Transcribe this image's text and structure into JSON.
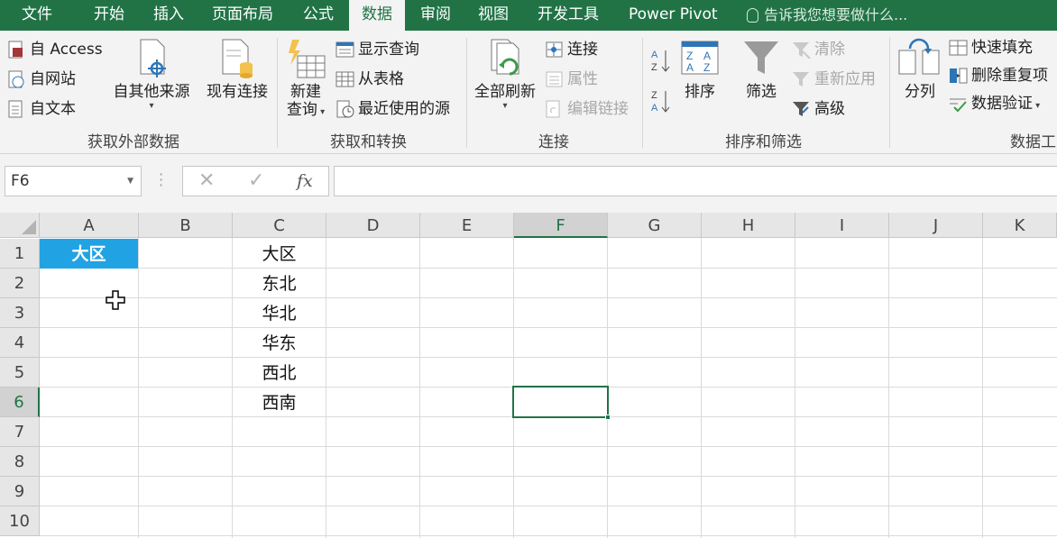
{
  "tabs": [
    "文件",
    "开始",
    "插入",
    "页面布局",
    "公式",
    "数据",
    "审阅",
    "视图",
    "开发工具",
    "Power Pivot"
  ],
  "active_tab": "数据",
  "tell_me": "告诉我您想要做什么...",
  "ribbon": {
    "get_external": {
      "label": "获取外部数据",
      "from_access": "自 Access",
      "from_web": "自网站",
      "from_text": "自文本",
      "other_sources": "自其他来源",
      "existing_connections": "现有连接"
    },
    "get_transform": {
      "label": "获取和转换",
      "new_query_1": "新建",
      "new_query_2": "查询",
      "show_queries": "显示查询",
      "from_table": "从表格",
      "recent_sources": "最近使用的源"
    },
    "connections": {
      "label": "连接",
      "refresh_all": "全部刷新",
      "connections": "连接",
      "properties": "属性",
      "edit_links": "编辑链接"
    },
    "sort_filter": {
      "label": "排序和筛选",
      "sort": "排序",
      "filter": "筛选",
      "clear": "清除",
      "reapply": "重新应用",
      "advanced": "高级"
    },
    "data_tools": {
      "label": "数据工",
      "text_to_columns": "分列",
      "flash_fill": "快速填充",
      "remove_duplicates": "删除重复项",
      "data_validation": "数据验证"
    }
  },
  "name_box": "F6",
  "formula_fx": "fx",
  "formula_value": "",
  "columns": [
    "A",
    "B",
    "C",
    "D",
    "E",
    "F",
    "G",
    "H",
    "I",
    "J",
    "K"
  ],
  "selected_column": "F",
  "rows": [
    "1",
    "2",
    "3",
    "4",
    "5",
    "6",
    "7",
    "8",
    "9",
    "10"
  ],
  "selected_row": "6",
  "cells": {
    "A1": "大区",
    "C1": "大区",
    "C2": "东北",
    "C3": "华北",
    "C4": "华东",
    "C5": "西北",
    "C6": "西南"
  },
  "colors": {
    "brand": "#217346",
    "header_fill": "#21a3e3"
  }
}
